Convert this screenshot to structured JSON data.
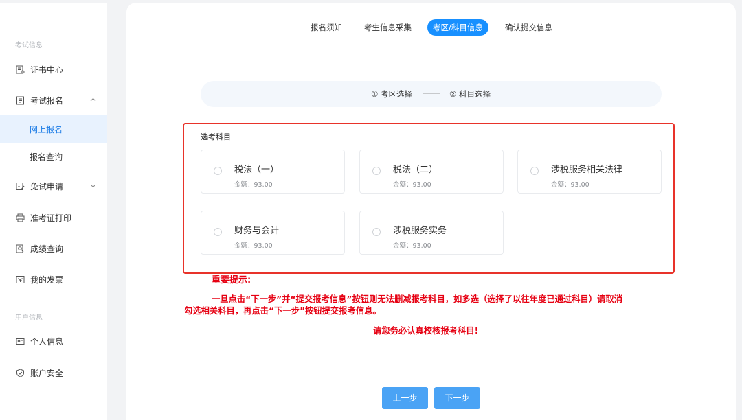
{
  "sidebar": {
    "section_exam": "考试信息",
    "section_user": "用户信息",
    "items": {
      "certificate": "证书中心",
      "registration": "考试报名",
      "online_registration": "网上报名",
      "registration_query": "报名查询",
      "exemption": "免试申请",
      "admission_print": "准考证打印",
      "score_query": "成绩查询",
      "invoice": "我的发票",
      "personal_info": "个人信息",
      "account_security": "账户安全"
    }
  },
  "tabs": [
    "报名须知",
    "考生信息采集",
    "考区/科目信息",
    "确认提交信息"
  ],
  "steps": {
    "step1": "① 考区选择",
    "step2": "② 科目选择"
  },
  "subjects": {
    "section_title": "选考科目",
    "amount_label": "金额：",
    "items": [
      {
        "name": "税法（一）",
        "amount": "93.00"
      },
      {
        "name": "税法（二）",
        "amount": "93.00"
      },
      {
        "name": "涉税服务相关法律",
        "amount": "93.00"
      },
      {
        "name": "财务与会计",
        "amount": "93.00"
      },
      {
        "name": "涉税服务实务",
        "amount": "93.00"
      }
    ]
  },
  "notice": {
    "title": "重要提示:",
    "line1": "一旦点击“下一步”并“提交报考信息”按钮则无法删减报考科目，如多选（选择了以往年度已通过科目）请取消",
    "line2": "勾选相关科目，再点击“下一步”按钮提交报考信息。",
    "emphasis": "请您务必认真校核报考科目!"
  },
  "buttons": {
    "prev": "上一步",
    "next": "下一步"
  },
  "colors": {
    "accent": "#1890ff",
    "active_bg": "#e8f2fe",
    "warning": "#e60012",
    "button": "#4aa3f5"
  }
}
